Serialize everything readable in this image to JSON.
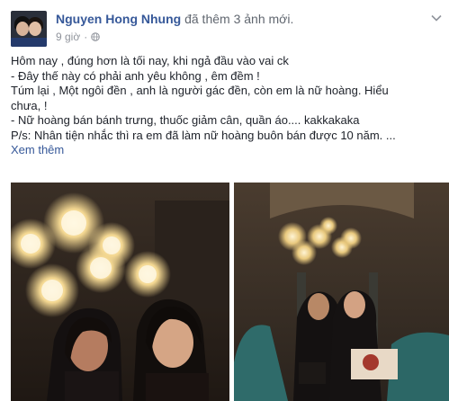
{
  "post": {
    "author": "Nguyen Hong Nhung",
    "action": "đã thêm 3 ảnh mới.",
    "time": "9 giờ",
    "separator": "·",
    "lines": [
      "Hôm nay , đúng hơn là tối nay, khi ngả đầu vào vai ck",
      "- Đây thế này có phải anh yêu không , êm đềm !",
      "Túm lại , Một ngôi đền , anh là người gác đền, còn em là nữ hoàng. Hiểu",
      "chưa, !",
      "- Nữ hoàng bán bánh trưng, thuốc giảm cân, quần áo.... kakkakaka",
      "P/s: Nhân tiện nhắc thì ra em đã làm nữ hoàng buôn bán được 10 năm. ..."
    ],
    "see_more": "Xem thêm"
  },
  "icons": {
    "privacy": "globe-icon",
    "menu": "chevron-down-icon"
  },
  "colors": {
    "link": "#365899",
    "meta": "#90949c",
    "text": "#1d2129"
  }
}
